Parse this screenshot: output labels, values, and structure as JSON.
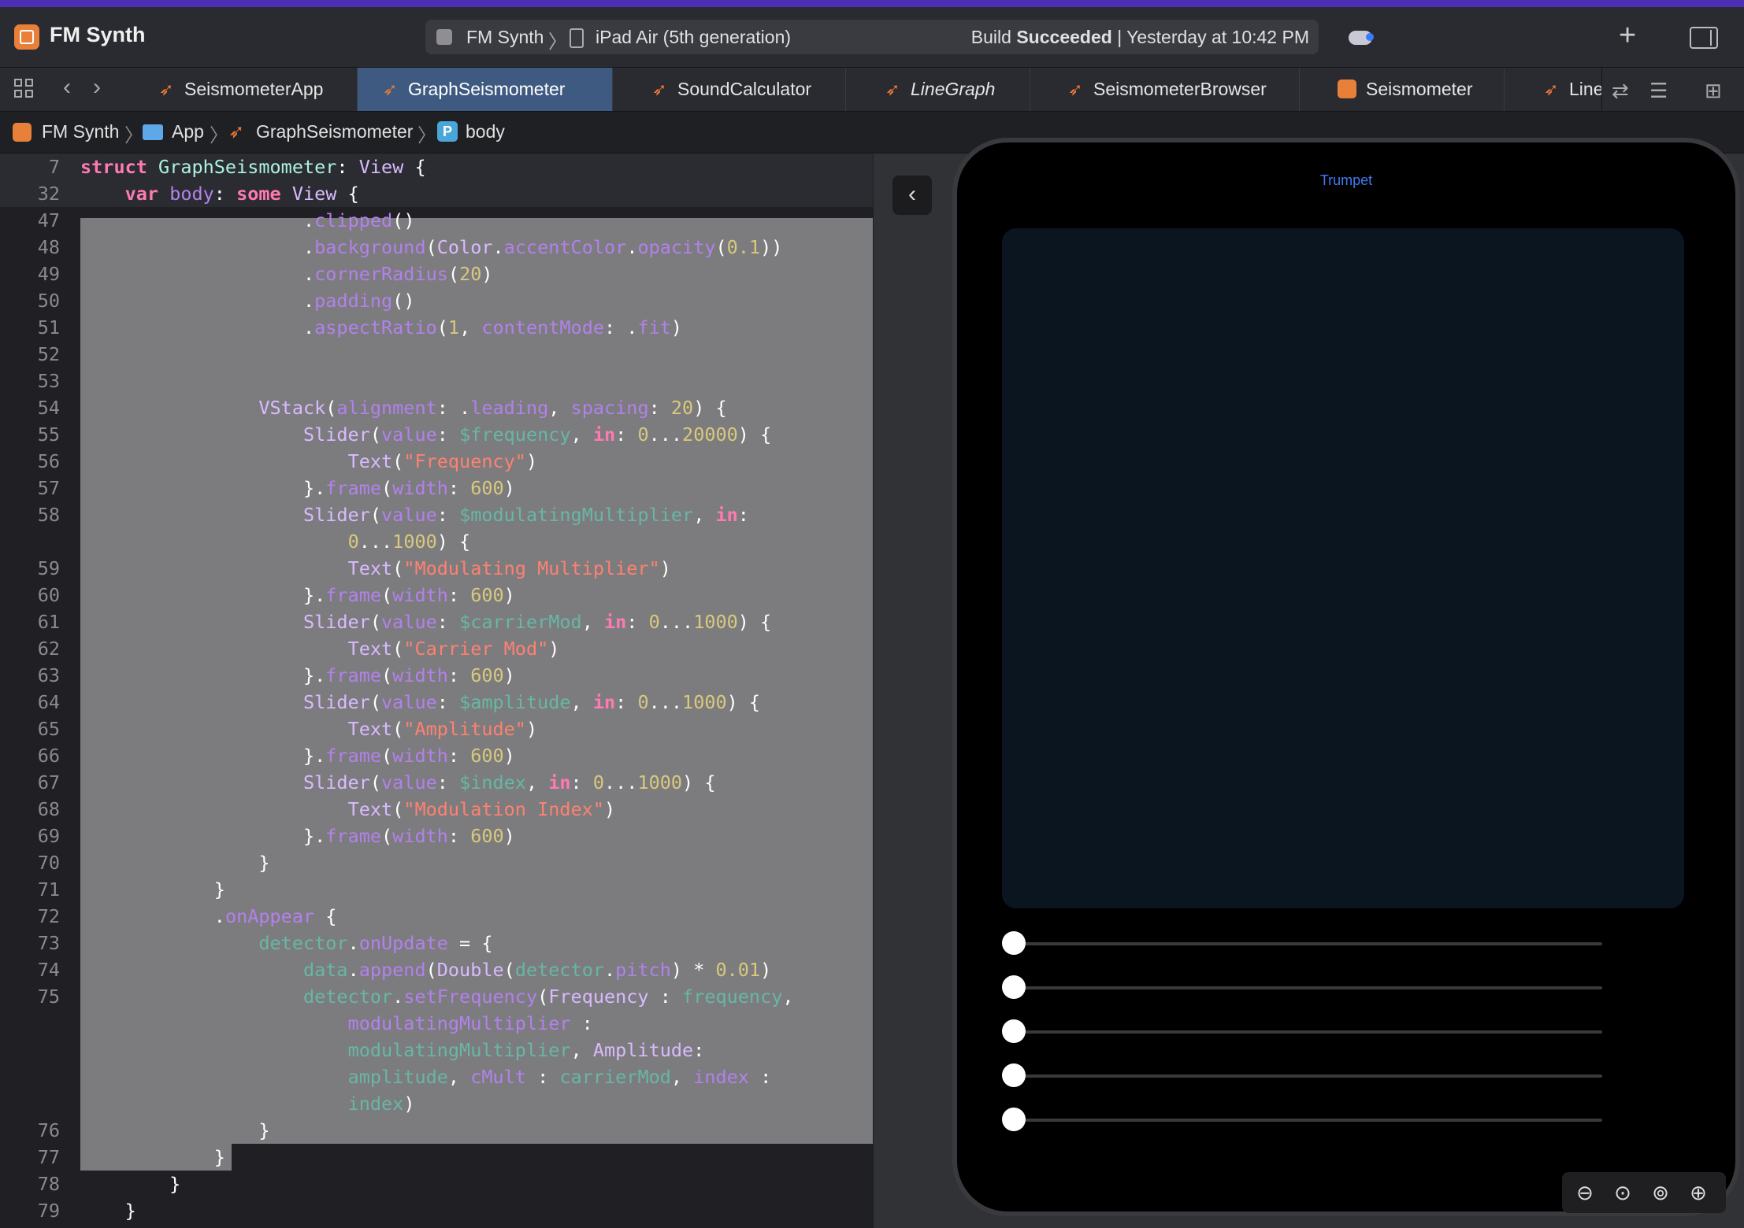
{
  "window": {
    "app_title": "FM Synth",
    "scheme_target": "FM Synth",
    "scheme_device": "iPad Air (5th generation)",
    "build_status_prefix": "Build",
    "build_status_bold": "Succeeded",
    "build_status_time": "| Yesterday at 10:42 PM"
  },
  "tabs": [
    {
      "label": "SeismometerApp",
      "icon": "swift-icon"
    },
    {
      "label": "GraphSeismometer",
      "icon": "swift-icon",
      "active": true
    },
    {
      "label": "SoundCalculator",
      "icon": "swift-icon"
    },
    {
      "label": "LineGraph",
      "icon": "swift-icon",
      "italic": true
    },
    {
      "label": "SeismometerBrowser",
      "icon": "swift-icon"
    },
    {
      "label": "Seismometer",
      "icon": "project-icon"
    },
    {
      "label": "Line",
      "icon": "swift-icon"
    }
  ],
  "breadcrumb": {
    "project": "FM Synth",
    "folder": "App",
    "file": "GraphSeismometer",
    "symbol_badge": "P",
    "symbol": "body"
  },
  "editor": {
    "sticky_lines": [
      {
        "n": "7",
        "text": "struct GraphSeismometer: View {"
      },
      {
        "n": "32",
        "text": "    var body: some View {"
      }
    ],
    "lines": [
      {
        "n": "47",
        "text": "                    .clipped()"
      },
      {
        "n": "48",
        "text": "                    .background(Color.accentColor.opacity(0.1))"
      },
      {
        "n": "49",
        "text": "                    .cornerRadius(20)"
      },
      {
        "n": "50",
        "text": "                    .padding()"
      },
      {
        "n": "51",
        "text": "                    .aspectRatio(1, contentMode: .fit)"
      },
      {
        "n": "52",
        "text": ""
      },
      {
        "n": "53",
        "text": ""
      },
      {
        "n": "54",
        "text": "                VStack(alignment: .leading, spacing: 20) {"
      },
      {
        "n": "55",
        "text": "                    Slider(value: $frequency, in: 0...20000) {"
      },
      {
        "n": "56",
        "text": "                        Text(\"Frequency\")"
      },
      {
        "n": "57",
        "text": "                    }.frame(width: 600)"
      },
      {
        "n": "58",
        "text": "                    Slider(value: $modulatingMultiplier, in:"
      },
      {
        "n": "",
        "text": "                        0...1000) {"
      },
      {
        "n": "59",
        "text": "                        Text(\"Modulating Multiplier\")"
      },
      {
        "n": "60",
        "text": "                    }.frame(width: 600)"
      },
      {
        "n": "61",
        "text": "                    Slider(value: $carrierMod, in: 0...1000) {"
      },
      {
        "n": "62",
        "text": "                        Text(\"Carrier Mod\")"
      },
      {
        "n": "63",
        "text": "                    }.frame(width: 600)"
      },
      {
        "n": "64",
        "text": "                    Slider(value: $amplitude, in: 0...1000) {"
      },
      {
        "n": "65",
        "text": "                        Text(\"Amplitude\")"
      },
      {
        "n": "66",
        "text": "                    }.frame(width: 600)"
      },
      {
        "n": "67",
        "text": "                    Slider(value: $index, in: 0...1000) {"
      },
      {
        "n": "68",
        "text": "                        Text(\"Modulation Index\")"
      },
      {
        "n": "69",
        "text": "                    }.frame(width: 600)"
      },
      {
        "n": "70",
        "text": "                }"
      },
      {
        "n": "71",
        "text": "            }"
      },
      {
        "n": "72",
        "text": "            .onAppear {"
      },
      {
        "n": "73",
        "text": "                detector.onUpdate = {"
      },
      {
        "n": "74",
        "text": "                    data.append(Double(detector.pitch) * 0.01)"
      },
      {
        "n": "75",
        "text": "                    detector.setFrequency(Frequency : frequency,"
      },
      {
        "n": "",
        "text": "                        modulatingMultiplier :"
      },
      {
        "n": "",
        "text": "                        modulatingMultiplier, Amplitude:"
      },
      {
        "n": "",
        "text": "                        amplitude, cMult : carrierMod, index :"
      },
      {
        "n": "",
        "text": "                        index)"
      },
      {
        "n": "76",
        "text": "                }"
      },
      {
        "n": "77",
        "text": "            }"
      },
      {
        "n": "78",
        "text": "        }"
      },
      {
        "n": "79",
        "text": "    }"
      }
    ]
  },
  "preview": {
    "title": "Trumpet",
    "sliders": [
      {
        "value": 0.0
      },
      {
        "value": 0.0
      },
      {
        "value": 0.0
      },
      {
        "value": 0.0
      },
      {
        "value": 0.0
      }
    ]
  },
  "colors": {
    "accent": "#3d7bf0",
    "selection": "#7c7c7f",
    "keyword": "#ff7ab2",
    "string": "#ff8170",
    "number": "#d9c97c"
  }
}
